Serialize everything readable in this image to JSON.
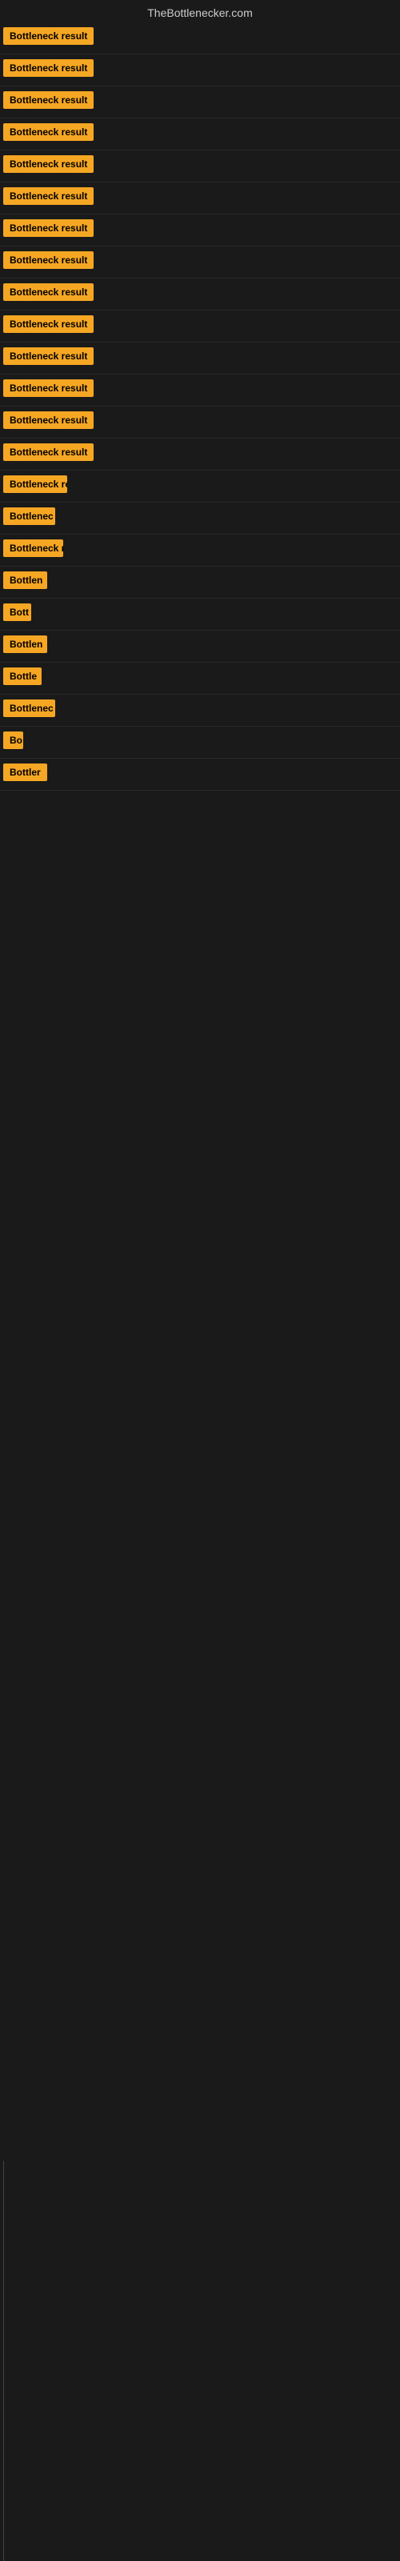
{
  "site": {
    "title": "TheBottlenecker.com"
  },
  "results": [
    {
      "id": 1,
      "label": "Bottleneck result",
      "visible_chars": 16
    },
    {
      "id": 2,
      "label": "Bottleneck result",
      "visible_chars": 16
    },
    {
      "id": 3,
      "label": "Bottleneck result",
      "visible_chars": 16
    },
    {
      "id": 4,
      "label": "Bottleneck result",
      "visible_chars": 16
    },
    {
      "id": 5,
      "label": "Bottleneck result",
      "visible_chars": 16
    },
    {
      "id": 6,
      "label": "Bottleneck result",
      "visible_chars": 16
    },
    {
      "id": 7,
      "label": "Bottleneck result",
      "visible_chars": 16
    },
    {
      "id": 8,
      "label": "Bottleneck result",
      "visible_chars": 16
    },
    {
      "id": 9,
      "label": "Bottleneck result",
      "visible_chars": 16
    },
    {
      "id": 10,
      "label": "Bottleneck result",
      "visible_chars": 16
    },
    {
      "id": 11,
      "label": "Bottleneck result",
      "visible_chars": 16
    },
    {
      "id": 12,
      "label": "Bottleneck result",
      "visible_chars": 16
    },
    {
      "id": 13,
      "label": "Bottleneck result",
      "visible_chars": 16
    },
    {
      "id": 14,
      "label": "Bottleneck result",
      "visible_chars": 16
    },
    {
      "id": 15,
      "label": "Bottleneck re",
      "visible_chars": 13
    },
    {
      "id": 16,
      "label": "Bottlenec",
      "visible_chars": 9
    },
    {
      "id": 17,
      "label": "Bottleneck r",
      "visible_chars": 12
    },
    {
      "id": 18,
      "label": "Bottlen",
      "visible_chars": 7
    },
    {
      "id": 19,
      "label": "Bott",
      "visible_chars": 4
    },
    {
      "id": 20,
      "label": "Bottlen",
      "visible_chars": 7
    },
    {
      "id": 21,
      "label": "Bottle",
      "visible_chars": 6
    },
    {
      "id": 22,
      "label": "Bottlenec",
      "visible_chars": 9
    },
    {
      "id": 23,
      "label": "Bo",
      "visible_chars": 2
    },
    {
      "id": 24,
      "label": "Bottler",
      "visible_chars": 7
    }
  ]
}
